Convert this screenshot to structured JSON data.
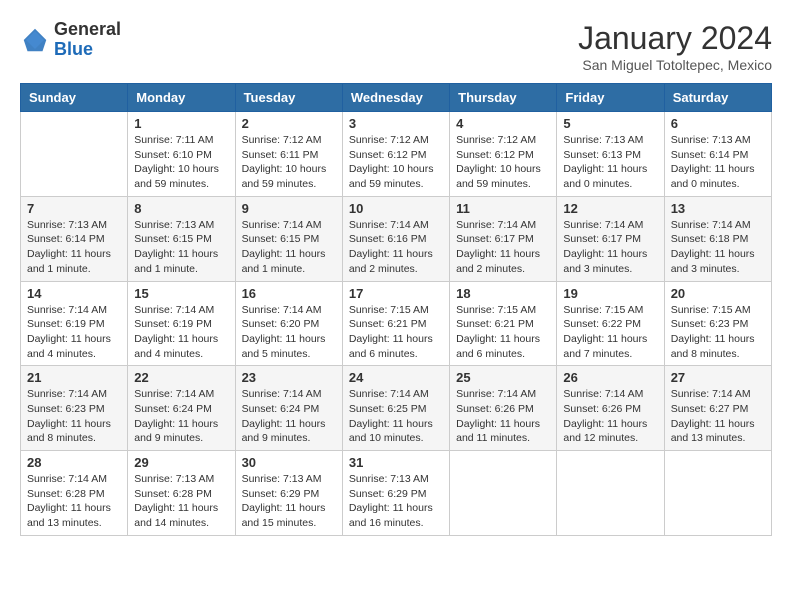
{
  "header": {
    "logo_general": "General",
    "logo_blue": "Blue",
    "month": "January 2024",
    "location": "San Miguel Totoltepec, Mexico"
  },
  "weekdays": [
    "Sunday",
    "Monday",
    "Tuesday",
    "Wednesday",
    "Thursday",
    "Friday",
    "Saturday"
  ],
  "weeks": [
    [
      {
        "day": "",
        "info": ""
      },
      {
        "day": "1",
        "info": "Sunrise: 7:11 AM\nSunset: 6:10 PM\nDaylight: 10 hours\nand 59 minutes."
      },
      {
        "day": "2",
        "info": "Sunrise: 7:12 AM\nSunset: 6:11 PM\nDaylight: 10 hours\nand 59 minutes."
      },
      {
        "day": "3",
        "info": "Sunrise: 7:12 AM\nSunset: 6:12 PM\nDaylight: 10 hours\nand 59 minutes."
      },
      {
        "day": "4",
        "info": "Sunrise: 7:12 AM\nSunset: 6:12 PM\nDaylight: 10 hours\nand 59 minutes."
      },
      {
        "day": "5",
        "info": "Sunrise: 7:13 AM\nSunset: 6:13 PM\nDaylight: 11 hours\nand 0 minutes."
      },
      {
        "day": "6",
        "info": "Sunrise: 7:13 AM\nSunset: 6:14 PM\nDaylight: 11 hours\nand 0 minutes."
      }
    ],
    [
      {
        "day": "7",
        "info": "Sunrise: 7:13 AM\nSunset: 6:14 PM\nDaylight: 11 hours\nand 1 minute."
      },
      {
        "day": "8",
        "info": "Sunrise: 7:13 AM\nSunset: 6:15 PM\nDaylight: 11 hours\nand 1 minute."
      },
      {
        "day": "9",
        "info": "Sunrise: 7:14 AM\nSunset: 6:15 PM\nDaylight: 11 hours\nand 1 minute."
      },
      {
        "day": "10",
        "info": "Sunrise: 7:14 AM\nSunset: 6:16 PM\nDaylight: 11 hours\nand 2 minutes."
      },
      {
        "day": "11",
        "info": "Sunrise: 7:14 AM\nSunset: 6:17 PM\nDaylight: 11 hours\nand 2 minutes."
      },
      {
        "day": "12",
        "info": "Sunrise: 7:14 AM\nSunset: 6:17 PM\nDaylight: 11 hours\nand 3 minutes."
      },
      {
        "day": "13",
        "info": "Sunrise: 7:14 AM\nSunset: 6:18 PM\nDaylight: 11 hours\nand 3 minutes."
      }
    ],
    [
      {
        "day": "14",
        "info": "Sunrise: 7:14 AM\nSunset: 6:19 PM\nDaylight: 11 hours\nand 4 minutes."
      },
      {
        "day": "15",
        "info": "Sunrise: 7:14 AM\nSunset: 6:19 PM\nDaylight: 11 hours\nand 4 minutes."
      },
      {
        "day": "16",
        "info": "Sunrise: 7:14 AM\nSunset: 6:20 PM\nDaylight: 11 hours\nand 5 minutes."
      },
      {
        "day": "17",
        "info": "Sunrise: 7:15 AM\nSunset: 6:21 PM\nDaylight: 11 hours\nand 6 minutes."
      },
      {
        "day": "18",
        "info": "Sunrise: 7:15 AM\nSunset: 6:21 PM\nDaylight: 11 hours\nand 6 minutes."
      },
      {
        "day": "19",
        "info": "Sunrise: 7:15 AM\nSunset: 6:22 PM\nDaylight: 11 hours\nand 7 minutes."
      },
      {
        "day": "20",
        "info": "Sunrise: 7:15 AM\nSunset: 6:23 PM\nDaylight: 11 hours\nand 8 minutes."
      }
    ],
    [
      {
        "day": "21",
        "info": "Sunrise: 7:14 AM\nSunset: 6:23 PM\nDaylight: 11 hours\nand 8 minutes."
      },
      {
        "day": "22",
        "info": "Sunrise: 7:14 AM\nSunset: 6:24 PM\nDaylight: 11 hours\nand 9 minutes."
      },
      {
        "day": "23",
        "info": "Sunrise: 7:14 AM\nSunset: 6:24 PM\nDaylight: 11 hours\nand 9 minutes."
      },
      {
        "day": "24",
        "info": "Sunrise: 7:14 AM\nSunset: 6:25 PM\nDaylight: 11 hours\nand 10 minutes."
      },
      {
        "day": "25",
        "info": "Sunrise: 7:14 AM\nSunset: 6:26 PM\nDaylight: 11 hours\nand 11 minutes."
      },
      {
        "day": "26",
        "info": "Sunrise: 7:14 AM\nSunset: 6:26 PM\nDaylight: 11 hours\nand 12 minutes."
      },
      {
        "day": "27",
        "info": "Sunrise: 7:14 AM\nSunset: 6:27 PM\nDaylight: 11 hours\nand 13 minutes."
      }
    ],
    [
      {
        "day": "28",
        "info": "Sunrise: 7:14 AM\nSunset: 6:28 PM\nDaylight: 11 hours\nand 13 minutes."
      },
      {
        "day": "29",
        "info": "Sunrise: 7:13 AM\nSunset: 6:28 PM\nDaylight: 11 hours\nand 14 minutes."
      },
      {
        "day": "30",
        "info": "Sunrise: 7:13 AM\nSunset: 6:29 PM\nDaylight: 11 hours\nand 15 minutes."
      },
      {
        "day": "31",
        "info": "Sunrise: 7:13 AM\nSunset: 6:29 PM\nDaylight: 11 hours\nand 16 minutes."
      },
      {
        "day": "",
        "info": ""
      },
      {
        "day": "",
        "info": ""
      },
      {
        "day": "",
        "info": ""
      }
    ]
  ]
}
